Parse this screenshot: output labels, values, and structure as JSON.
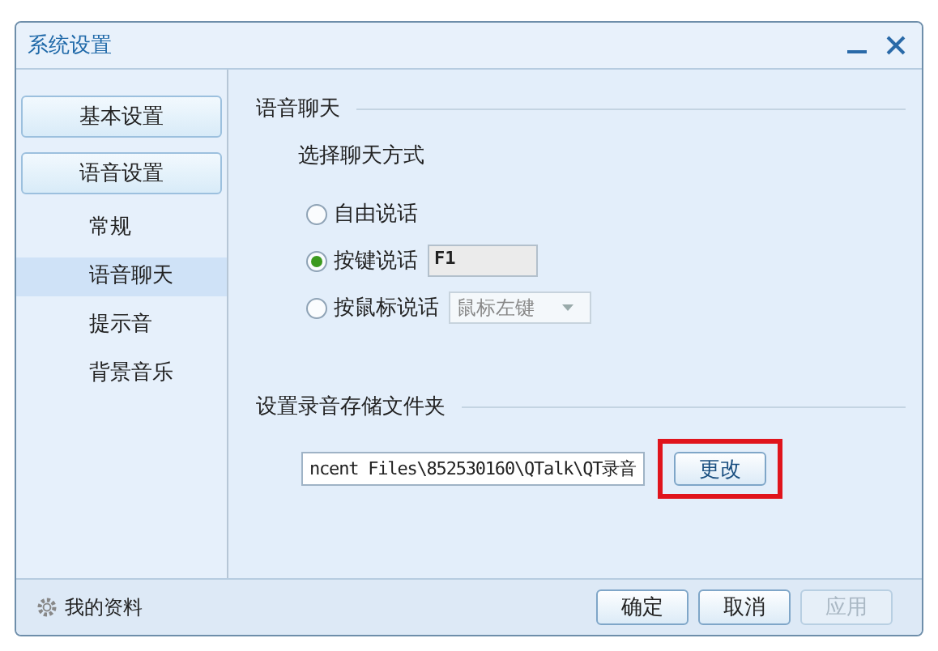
{
  "window": {
    "title": "系统设置"
  },
  "sidebar": {
    "items": [
      {
        "kind": "group",
        "label": "基本设置",
        "selected": false
      },
      {
        "kind": "group",
        "label": "语音设置",
        "selected": false
      },
      {
        "kind": "item",
        "label": "常规",
        "selected": false
      },
      {
        "kind": "item",
        "label": "语音聊天",
        "selected": true
      },
      {
        "kind": "item",
        "label": "提示音",
        "selected": false
      },
      {
        "kind": "item",
        "label": "背景音乐",
        "selected": false
      }
    ]
  },
  "voice_chat": {
    "heading": "语音聊天",
    "subheading": "选择聊天方式",
    "options": [
      {
        "label": "自由说话",
        "selected": false
      },
      {
        "label": "按键说话",
        "selected": true,
        "kind": "key_field",
        "value": "F1"
      },
      {
        "label": "按鼠标说话",
        "selected": false,
        "kind": "dropdown",
        "value": "鼠标左键"
      }
    ]
  },
  "folder": {
    "heading": "设置录音存储文件夹",
    "path": "ncent Files\\852530160\\QTalk\\QT录音",
    "change_button": {
      "label": "更改",
      "highlighted": true
    }
  },
  "footer": {
    "profile_link": "我的资料",
    "buttons": [
      {
        "label": "确定",
        "disabled": false
      },
      {
        "label": "取消",
        "disabled": false
      },
      {
        "label": "应用",
        "disabled": true
      }
    ]
  }
}
